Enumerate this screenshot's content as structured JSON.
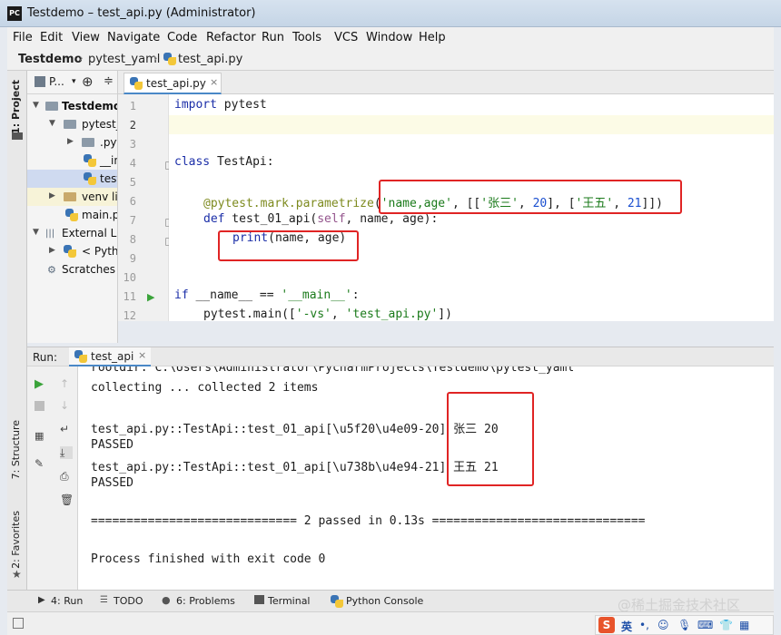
{
  "window": {
    "title": "Testdemo – test_api.py (Administrator)",
    "app_icon": "PC"
  },
  "menu": [
    "File",
    "Edit",
    "View",
    "Navigate",
    "Code",
    "Refactor",
    "Run",
    "Tools",
    "VCS",
    "Window",
    "Help"
  ],
  "breadcrumb": {
    "project": "Testdemo",
    "folder": "pytest_yaml",
    "file": "test_api.py"
  },
  "left_tabs": {
    "project": "1: Project",
    "structure": "7: Structure",
    "favorites": "2: Favorites"
  },
  "project": {
    "selector": "P...",
    "items": [
      {
        "label": "Testdemo"
      },
      {
        "label": "pytest_"
      },
      {
        "label": ".pyt"
      },
      {
        "label": "__in"
      },
      {
        "label": "test"
      },
      {
        "label": "venv  li"
      },
      {
        "label": "main.p"
      },
      {
        "label": "External L"
      },
      {
        "label": "< Pytho"
      },
      {
        "label": "Scratches"
      }
    ]
  },
  "editor": {
    "tab": "test_api.py",
    "line_numbers": [
      "1",
      "2",
      "3",
      "4",
      "5",
      "6",
      "7",
      "8",
      "9",
      "10",
      "11",
      "12"
    ]
  },
  "code": {
    "l1_kw": "import",
    "l1_rest": " pytest",
    "l4_kw": "class",
    "l4_rest": " TestApi:",
    "l6_dec": "@pytest.mark.parametrize",
    "l6_open": "(",
    "l6_s1": "'name,age'",
    "l6_c1": ", [[",
    "l6_s2": "'张三'",
    "l6_c2": ", ",
    "l6_n1": "20",
    "l6_c3": "], [",
    "l6_s3": "'王五'",
    "l6_c4": ", ",
    "l6_n2": "21",
    "l6_c5": "]])",
    "l7_kw": "def",
    "l7_fn": " test_01_api(",
    "l7_self": "self",
    "l7_rest": ", name, age):",
    "l8_fn": "print",
    "l8_rest": "(name, age)",
    "l11_kw": "if",
    "l11_a": " __name__ == ",
    "l11_s": "'__main__'",
    "l11_b": ":",
    "l12_a": "pytest.main([",
    "l12_s1": "'-vs'",
    "l12_c": ", ",
    "l12_s2": "'test_api.py'",
    "l12_b": "])"
  },
  "run": {
    "label": "Run:",
    "tab": "test_api"
  },
  "console": {
    "line0": "rootdir: C:\\Users\\Administrator\\PycharmProjects\\Testdemo\\pytest_yaml",
    "line1": "collecting ... collected 2 items",
    "line2": "test_api.py::TestApi::test_01_api[\\u5f20\\u4e09-20] 张三 20",
    "line3": "PASSED",
    "line4": "test_api.py::TestApi::test_01_api[\\u738b\\u4e94-21] 王五 21",
    "line5": "PASSED",
    "line6": "============================= 2 passed in 0.13s ==============================",
    "line7": "Process finished with exit code 0"
  },
  "bottom_tabs": [
    "4: Run",
    "TODO",
    "6: Problems",
    "Terminal",
    "Python Console"
  ],
  "watermark": "@稀土掘金技术社区",
  "ime": {
    "brand": "S",
    "lang": "英"
  }
}
